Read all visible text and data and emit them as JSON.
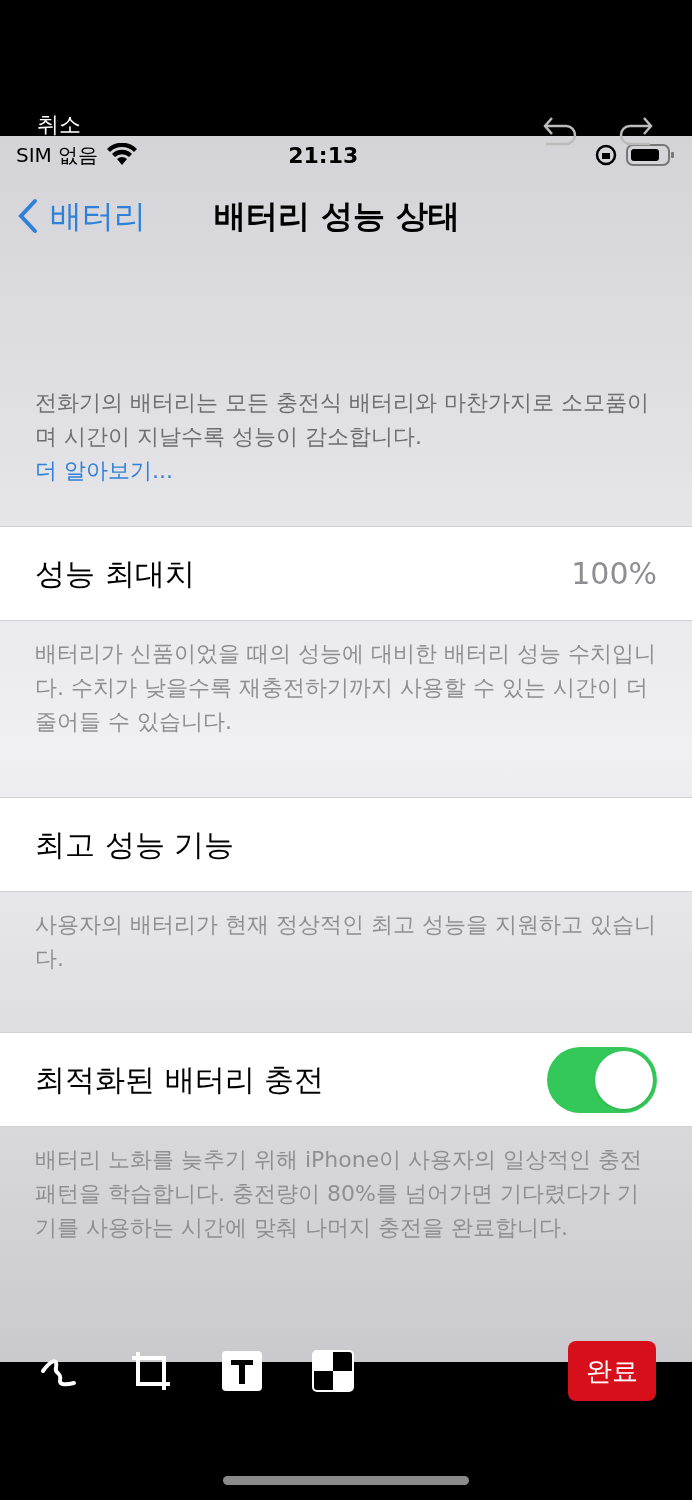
{
  "editor": {
    "cancel": "취소",
    "done": "완료"
  },
  "status_bar": {
    "carrier": "SIM 없음",
    "time": "21:13"
  },
  "nav": {
    "back": "배터리",
    "title": "배터리 성능 상태"
  },
  "intro": {
    "text": "전화기의 배터리는 모든 충전식 배터리와 마찬가지로 소모품이며 시간이 지날수록 성능이 감소합니다.",
    "link": "더 알아보기..."
  },
  "sections": [
    {
      "kind": "value",
      "label": "성능 최대치",
      "value": "100%",
      "footer": "배터리가 신품이었을 때의 성능에 대비한 배터리 성능 수치입니다. 수치가 낮을수록 재충전하기까지 사용할 수 있는 시간이 더 줄어들 수 있습니다."
    },
    {
      "kind": "plain",
      "label": "최고 성능 기능",
      "footer": "사용자의 배터리가 현재 정상적인 최고 성능을 지원하고 있습니다."
    },
    {
      "kind": "toggle",
      "label": "최적화된 배터리 충전",
      "on": true,
      "footer": "배터리 노화를 늦추기 위해 iPhone이 사용자의 일상적인 충전 패턴을 학습합니다. 충전량이 80%를 넘어가면 기다렸다가 기기를 사용하는 시간에 맞춰 나머지 충전을 완료합니다."
    }
  ]
}
